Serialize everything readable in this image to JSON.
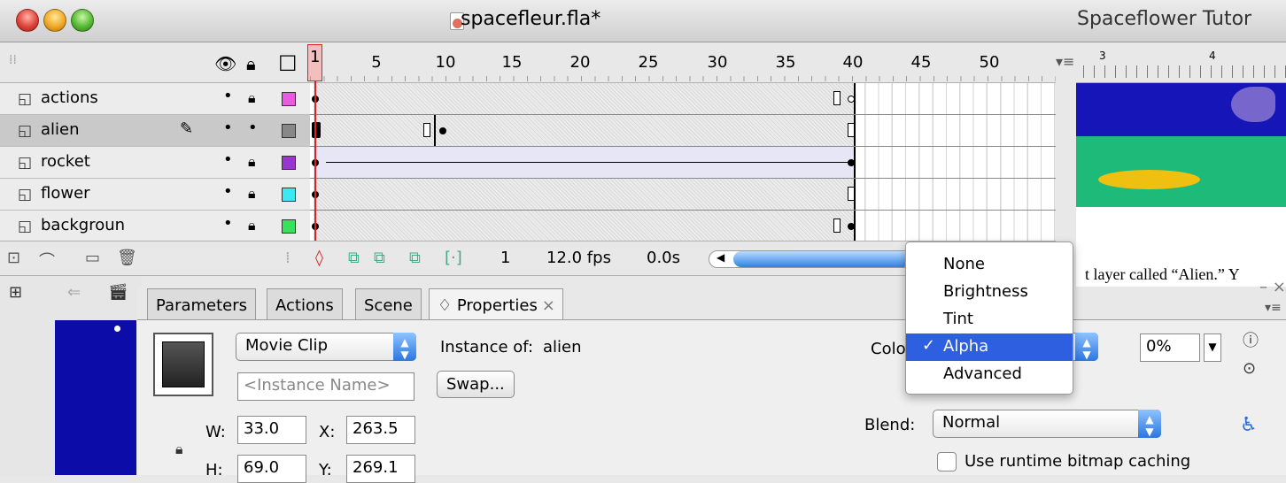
{
  "window": {
    "title": "spacefleur.fla*",
    "side_title": "Spaceflower Tutor"
  },
  "timeline": {
    "frame_numbers": [
      "1",
      "5",
      "10",
      "15",
      "20",
      "25",
      "30",
      "35",
      "40",
      "45",
      "50"
    ],
    "layers": [
      {
        "name": "actions"
      },
      {
        "name": "alien"
      },
      {
        "name": "rocket"
      },
      {
        "name": "flower"
      },
      {
        "name": "backgroun"
      }
    ],
    "layer_colors": [
      "#e95ae0",
      "#888888",
      "#9a36d0",
      "#3ce8f2",
      "#3ae05a"
    ],
    "current_frame": "1",
    "fps": "12.0 fps",
    "elapsed": "0.0s"
  },
  "stage": {
    "text": "t layer called “Alien.” Y"
  },
  "panel": {
    "tabs": [
      "Parameters",
      "Actions",
      "Scene",
      "♢ Properties"
    ],
    "symbol_type": "Movie Clip",
    "instance_of_label": "Instance of:",
    "instance_of_value": "alien",
    "instance_name_placeholder": "<Instance Name>",
    "swap_label": "Swap...",
    "w_label": "W:",
    "w_value": "33.0",
    "x_label": "X:",
    "x_value": "263.5",
    "h_label": "H:",
    "h_value": "69.0",
    "y_label": "Y:",
    "y_value": "269.1",
    "color_label": "Colo",
    "alpha_value": "0%",
    "blend_label": "Blend:",
    "blend_value": "Normal",
    "cache_label": "Use runtime bitmap caching"
  },
  "color_menu": {
    "items": [
      "None",
      "Brightness",
      "Tint",
      "Alpha",
      "Advanced"
    ],
    "selected": "Alpha"
  }
}
